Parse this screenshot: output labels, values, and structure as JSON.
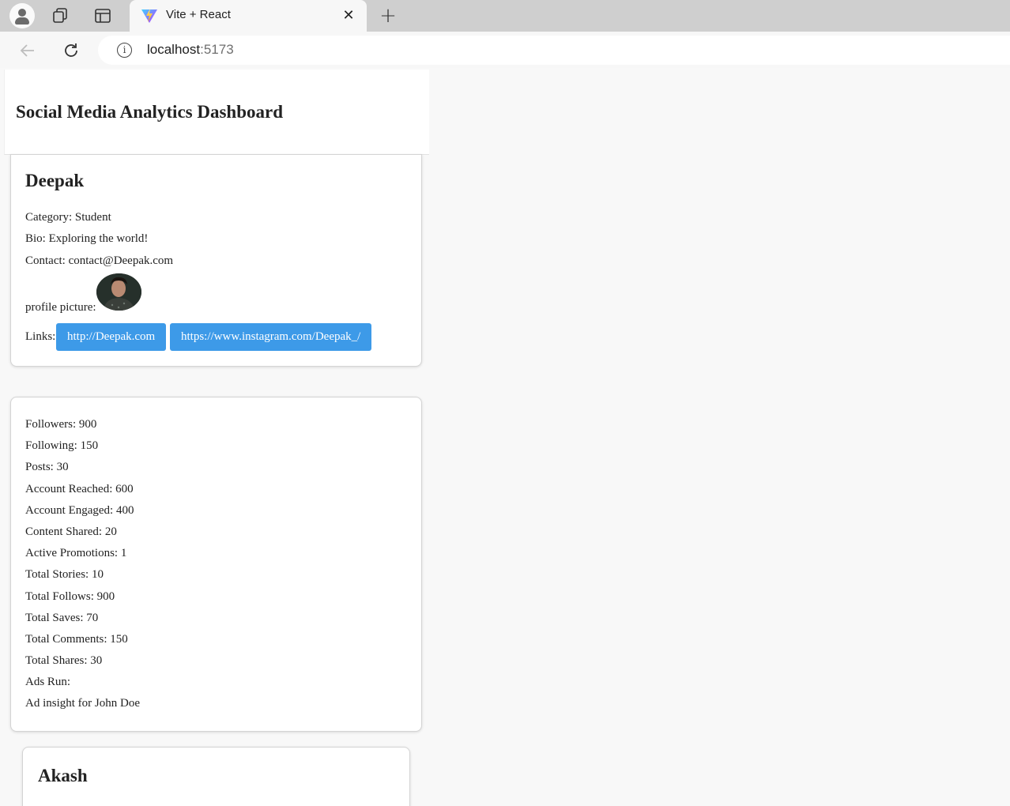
{
  "browser": {
    "tab_title": "Vite + React",
    "url_host": "localhost",
    "url_port": ":5173"
  },
  "header": {
    "title": "Social Media Analytics Dashboard"
  },
  "profile": {
    "name": "Deepak",
    "category": "Category: Student",
    "bio": "Bio: Exploring the world!",
    "contact": "Contact: contact@Deepak.com",
    "picture_label": "profile picture:",
    "links_label": "Links:",
    "links": [
      "http://Deepak.com",
      "https://www.instagram.com/Deepak_/"
    ]
  },
  "stats": [
    "Followers: 900",
    "Following: 150",
    "Posts: 30",
    "Account Reached: 600",
    "Account Engaged: 400",
    "Content Shared: 20",
    "Active Promotions: 1",
    "Total Stories: 10",
    "Total Follows: 900",
    "Total Saves: 70",
    "Total Comments: 150",
    "Total Shares: 30",
    "Ads Run:",
    "Ad insight for John Doe"
  ],
  "next_profile": {
    "name": "Akash"
  }
}
